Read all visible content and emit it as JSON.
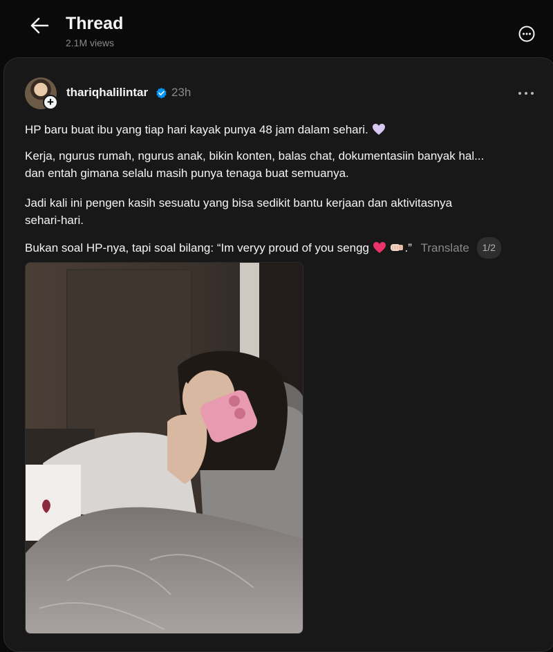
{
  "header": {
    "title": "Thread",
    "views": "2.1M views"
  },
  "post": {
    "username": "thariqhalilintar",
    "time": "23h",
    "paragraphs": [
      "HP baru buat ibu yang tiap hari kayak punya 48 jam dalam sehari.",
      "Kerja, ngurus rumah, ngurus anak, bikin konten, balas chat, dokumentasiin banyak hal...",
      "dan entah gimana selalu masih punya tenaga buat semuanya.",
      "Jadi kali ini pengen kasih sesuatu yang bisa sedikit bantu kerjaan dan aktivitasnya",
      "sehari-hari.",
      "Bukan soal HP-nya, tapi soal bilang: “Im veryy proud of you sengg",
      ".”"
    ],
    "translate_label": "Translate",
    "pager": "1/2"
  },
  "colors": {
    "background": "#0a0a0a",
    "card": "#181818",
    "verified": "#0095f6",
    "muted_text": "#8a8a8a"
  },
  "icons": [
    "back-arrow-icon",
    "more-circle-icon",
    "verified-badge-icon",
    "more-dots-icon",
    "follow-plus-icon",
    "heart-icon",
    "fist-bump-icon"
  ]
}
